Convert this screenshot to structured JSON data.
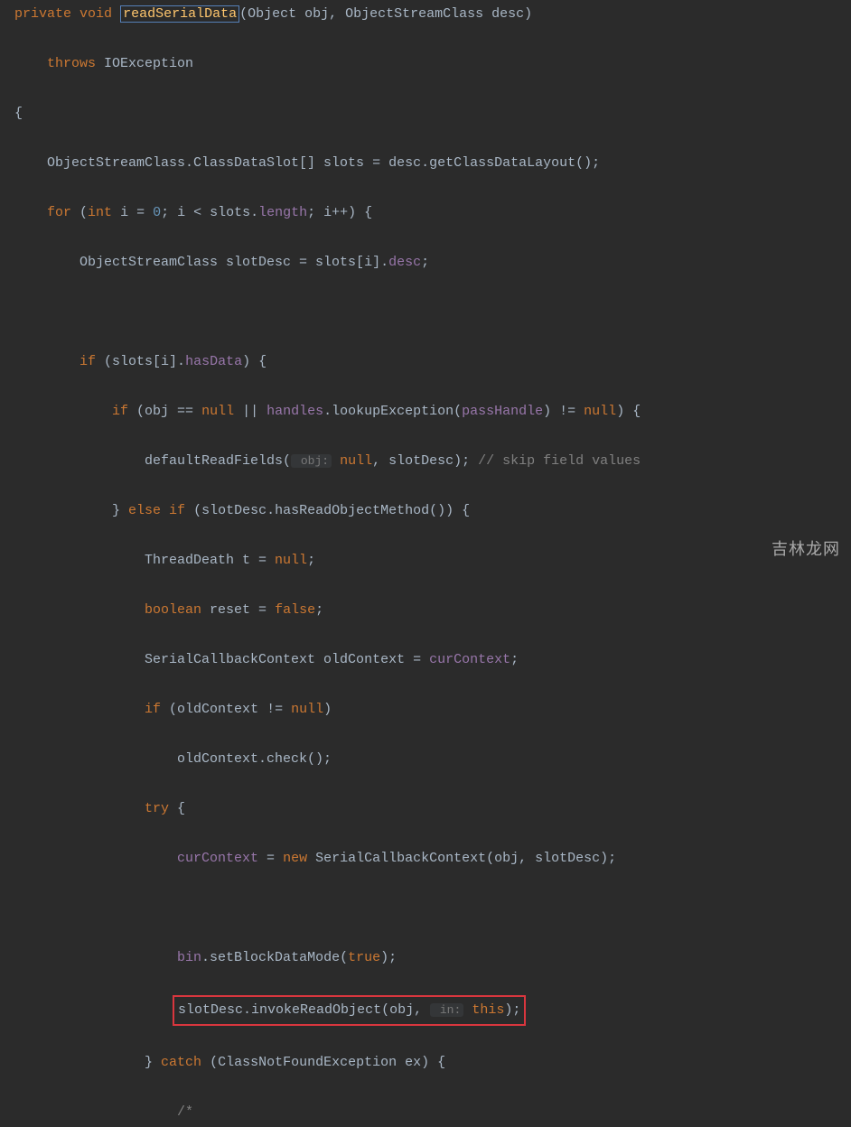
{
  "code": {
    "kw_private": "private",
    "kw_void": "void",
    "method_readSerialData": "readSerialData",
    "sig_params": "(Object obj, ObjectStreamClass desc)",
    "kw_throws": "throws",
    "type_IOException": "IOException",
    "brace_open": "{",
    "line_slots_pre": "    ObjectStreamClass.ClassDataSlot[] slots = desc.getClassDataLayout();",
    "kw_for": "for",
    "for_open": " (",
    "kw_int": "int",
    "for_init": " i = ",
    "num_0": "0",
    "for_semi1": "; i < slots.",
    "field_length": "length",
    "for_rest": "; i++) {",
    "line_slotDesc": "        ObjectStreamClass slotDesc = slots[i].",
    "field_desc": "desc",
    "semi": ";",
    "kw_if": "if",
    "if_hasData": " (slots[i].",
    "field_hasData": "hasData",
    "if_close": ") {",
    "if_objnull": " (obj == ",
    "kw_null": "null",
    "or": " || ",
    "field_handles": "handles",
    "lookupEx": ".lookupException(",
    "field_passHandle": "passHandle",
    "neq_null": ") != ",
    "if_end": ") {",
    "defaultRead": "                defaultReadFields(",
    "hint_obj": " obj:",
    "null_comma": ", slotDesc); ",
    "comment_skip": "// skip field values",
    "else_if": "} ",
    "kw_else": "else if",
    "hasReadObj": " (slotDesc.hasReadObjectMethod()) {",
    "threadDeath": "                ThreadDeath t = ",
    "kw_boolean": "boolean",
    "reset_eq": " reset = ",
    "kw_false": "false",
    "serialCtx": "                SerialCallbackContext oldContext = ",
    "field_curContext": "curContext",
    "if_oldCtx": " (oldContext != ",
    "paren_close": ")",
    "oldCtxCheck": "                    oldContext.check();",
    "kw_try": "try",
    "try_open": " {",
    "curCtx_eq": " = ",
    "kw_new": "new",
    "newCtx": " SerialCallbackContext(obj, slotDesc);",
    "bin_line_pre": "                    ",
    "field_bin": "bin",
    "setBlock": ".setBlockDataMode(",
    "kw_true": "true",
    "close_paren_semi": ");",
    "invoke_line": "slotDesc.invokeReadObject(obj, ",
    "hint_in": " in:",
    "this_close": ");",
    "kw_this": "this",
    "catch_line": "} ",
    "kw_catch": "catch",
    "catch_rest": " (ClassNotFoundException ex) {",
    "comment_start": "                    /*"
  },
  "watermark": "吉林龙网"
}
